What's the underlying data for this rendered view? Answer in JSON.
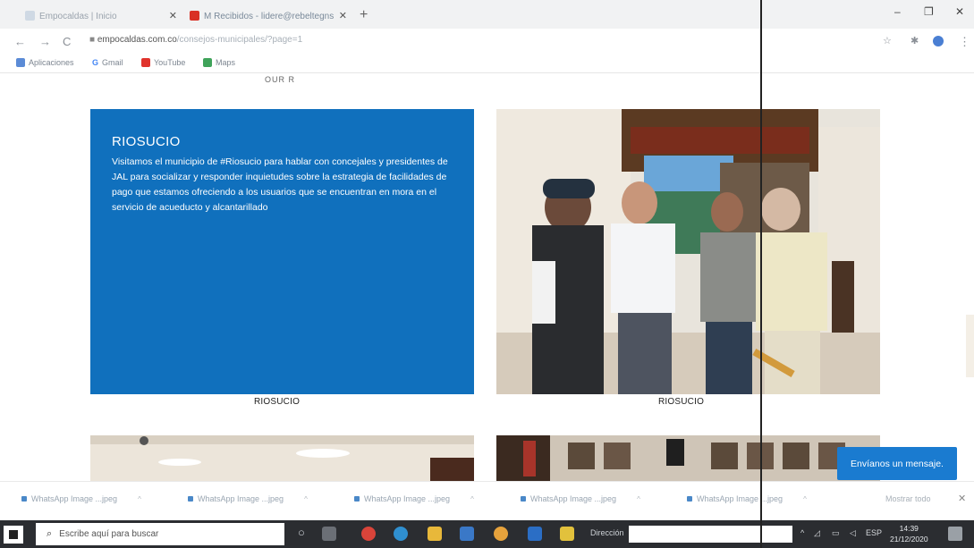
{
  "browser": {
    "tabs": [
      {
        "label": "Empocaldas | Inicio"
      },
      {
        "label": "M  Recibidos - lidere@rebeltegns"
      }
    ],
    "url_host": "empocaldas.com.co",
    "url_path": "/consejos-municipales/?page=1",
    "bookmarks": [
      "Aplicaciones",
      "Gmail",
      "YouTube",
      "Maps"
    ],
    "colors": {
      "tab2_fav": "#d93025",
      "profile": "#4a7fd3"
    }
  },
  "page": {
    "top_label": "OUR R",
    "card": {
      "title": "RIOSUCIO",
      "body": "Visitamos el municipio de #Riosucio para hablar con concejales y presidentes de JAL para socializar y responder inquietudes sobre la estrategia de facilidades de pago que estamos ofreciendo a los usuarios que se encuentran en mora en el servicio de acueducto y alcantarillado",
      "color": "#1070bd"
    },
    "captions": [
      "RIOSUCIO",
      "RIOSUCIO"
    ],
    "chat_button": "Envíanos un mensaje."
  },
  "downloads": {
    "items": [
      "WhatsApp Image ...jpeg",
      "WhatsApp Image ...jpeg",
      "WhatsApp Image ...jpeg",
      "WhatsApp Image ...jpeg",
      "WhatsApp Image ...jpeg"
    ],
    "show_all": "Mostrar todo"
  },
  "taskbar": {
    "search_placeholder": "Escribe aquí para buscar",
    "direccion_label": "Dirección",
    "lang": "ESP",
    "time": "14:39",
    "date": "21/12/2020"
  }
}
